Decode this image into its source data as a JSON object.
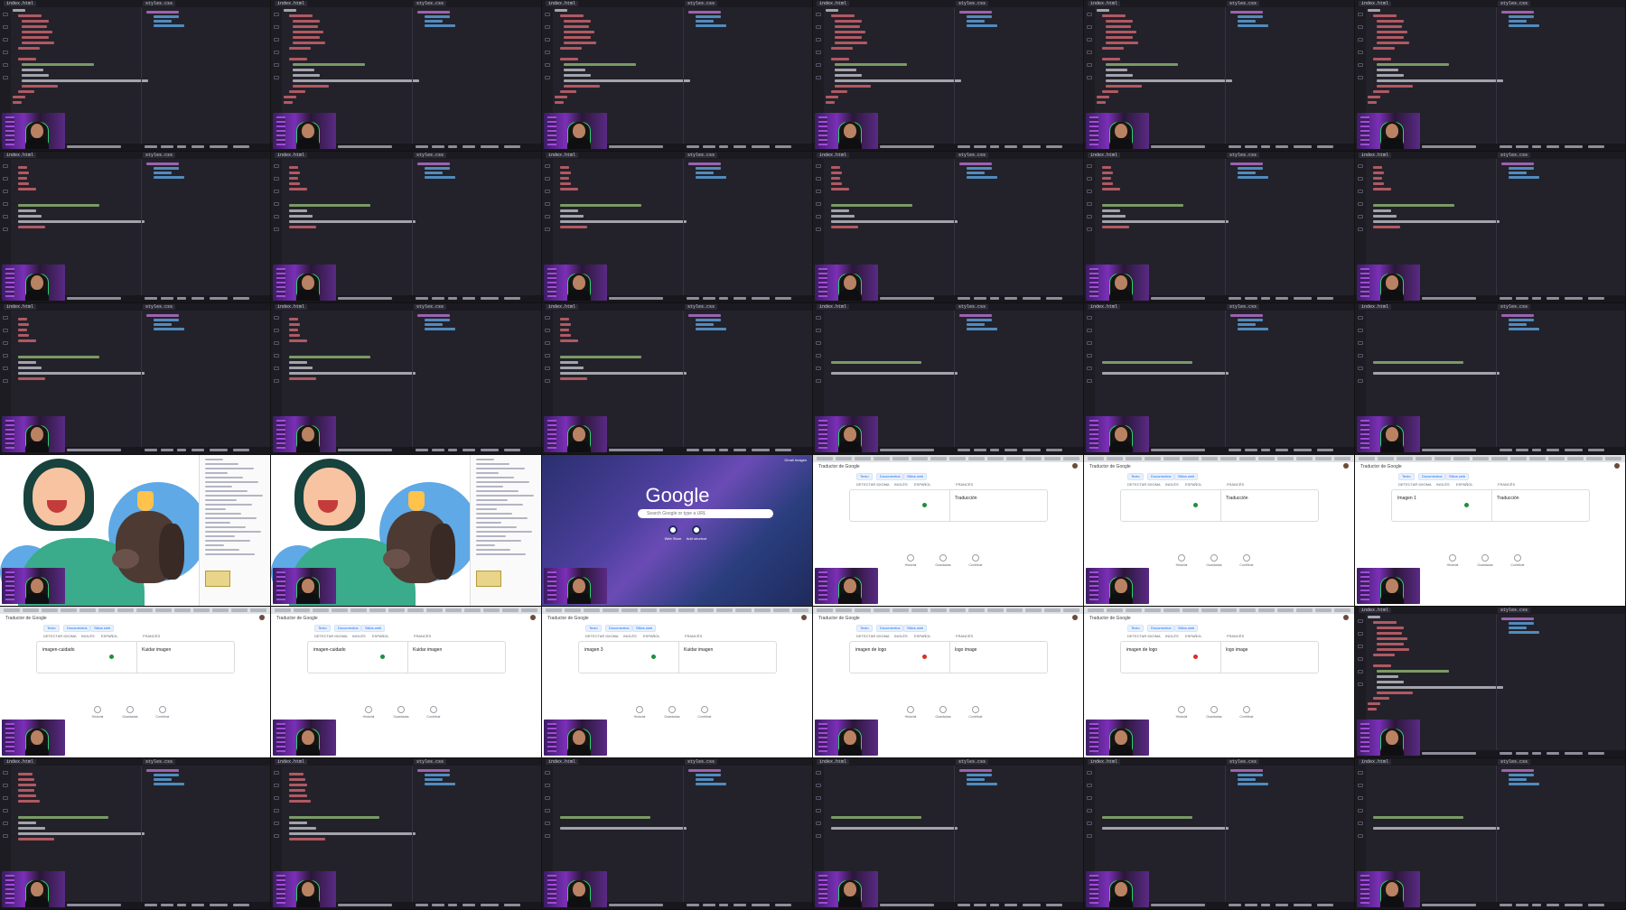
{
  "sheet": {
    "editor": {
      "file_tab": "index.html",
      "css_tab": "styles.css"
    },
    "google": {
      "logo": "Google",
      "top_links": "Gmail  Images",
      "search_placeholder": "Search Google or type a URL",
      "shortcuts": [
        "Web Store",
        "Add shortcut"
      ]
    },
    "translate": {
      "app_title": "Traductor de Google",
      "tabs": [
        "Texto",
        "Documentos",
        "Sitios web"
      ],
      "langs": [
        "DETECTAR IDIOMA",
        "INGLÉS",
        "ESPAÑOL",
        "FRANCÉS"
      ],
      "bottom": [
        "Historial",
        "Guardadas",
        "Contribuir"
      ]
    },
    "tiles": [
      {
        "kind": "editor",
        "variant": "a"
      },
      {
        "kind": "editor",
        "variant": "a"
      },
      {
        "kind": "editor",
        "variant": "a"
      },
      {
        "kind": "editor",
        "variant": "a"
      },
      {
        "kind": "editor",
        "variant": "a"
      },
      {
        "kind": "editor",
        "variant": "a"
      },
      {
        "kind": "editor",
        "variant": "b"
      },
      {
        "kind": "editor",
        "variant": "b"
      },
      {
        "kind": "editor",
        "variant": "b"
      },
      {
        "kind": "editor",
        "variant": "b"
      },
      {
        "kind": "editor",
        "variant": "b"
      },
      {
        "kind": "editor",
        "variant": "b"
      },
      {
        "kind": "editor",
        "variant": "b"
      },
      {
        "kind": "editor",
        "variant": "b"
      },
      {
        "kind": "editor",
        "variant": "b"
      },
      {
        "kind": "editor",
        "variant": "c"
      },
      {
        "kind": "editor",
        "variant": "c"
      },
      {
        "kind": "editor",
        "variant": "c"
      },
      {
        "kind": "illustration"
      },
      {
        "kind": "illustration"
      },
      {
        "kind": "google"
      },
      {
        "kind": "translate",
        "source": "",
        "target": "Traducción"
      },
      {
        "kind": "translate",
        "source": "",
        "target": "Traducción"
      },
      {
        "kind": "translate",
        "source": "Imagen 1",
        "target": "Traducción"
      },
      {
        "kind": "translate",
        "source": "imagen-cuidado",
        "target": "Kuidar imagen"
      },
      {
        "kind": "translate",
        "source": "imagen-cuidado",
        "target": "Kuidar imagen"
      },
      {
        "kind": "translate",
        "source": "imagen 3",
        "target": "Kuidar imagen"
      },
      {
        "kind": "translate",
        "source": "imagen de logo",
        "target": "logo image"
      },
      {
        "kind": "translate",
        "source": "imagen de logo",
        "target": "logo image"
      },
      {
        "kind": "editor",
        "variant": "a"
      },
      {
        "kind": "editor",
        "variant": "d"
      },
      {
        "kind": "editor",
        "variant": "d"
      },
      {
        "kind": "editor",
        "variant": "c"
      },
      {
        "kind": "editor",
        "variant": "c"
      },
      {
        "kind": "editor",
        "variant": "c"
      },
      {
        "kind": "editor",
        "variant": "c"
      }
    ]
  },
  "colors": {
    "editor_bg": "#23222b",
    "tag": "#e06c75",
    "attr": "#d19a66",
    "string": "#98c379",
    "text": "#cfcfd8",
    "keyword": "#c678dd",
    "value": "#61afef",
    "mic_green": "#1e8e3e",
    "mic_red": "#d93025"
  }
}
